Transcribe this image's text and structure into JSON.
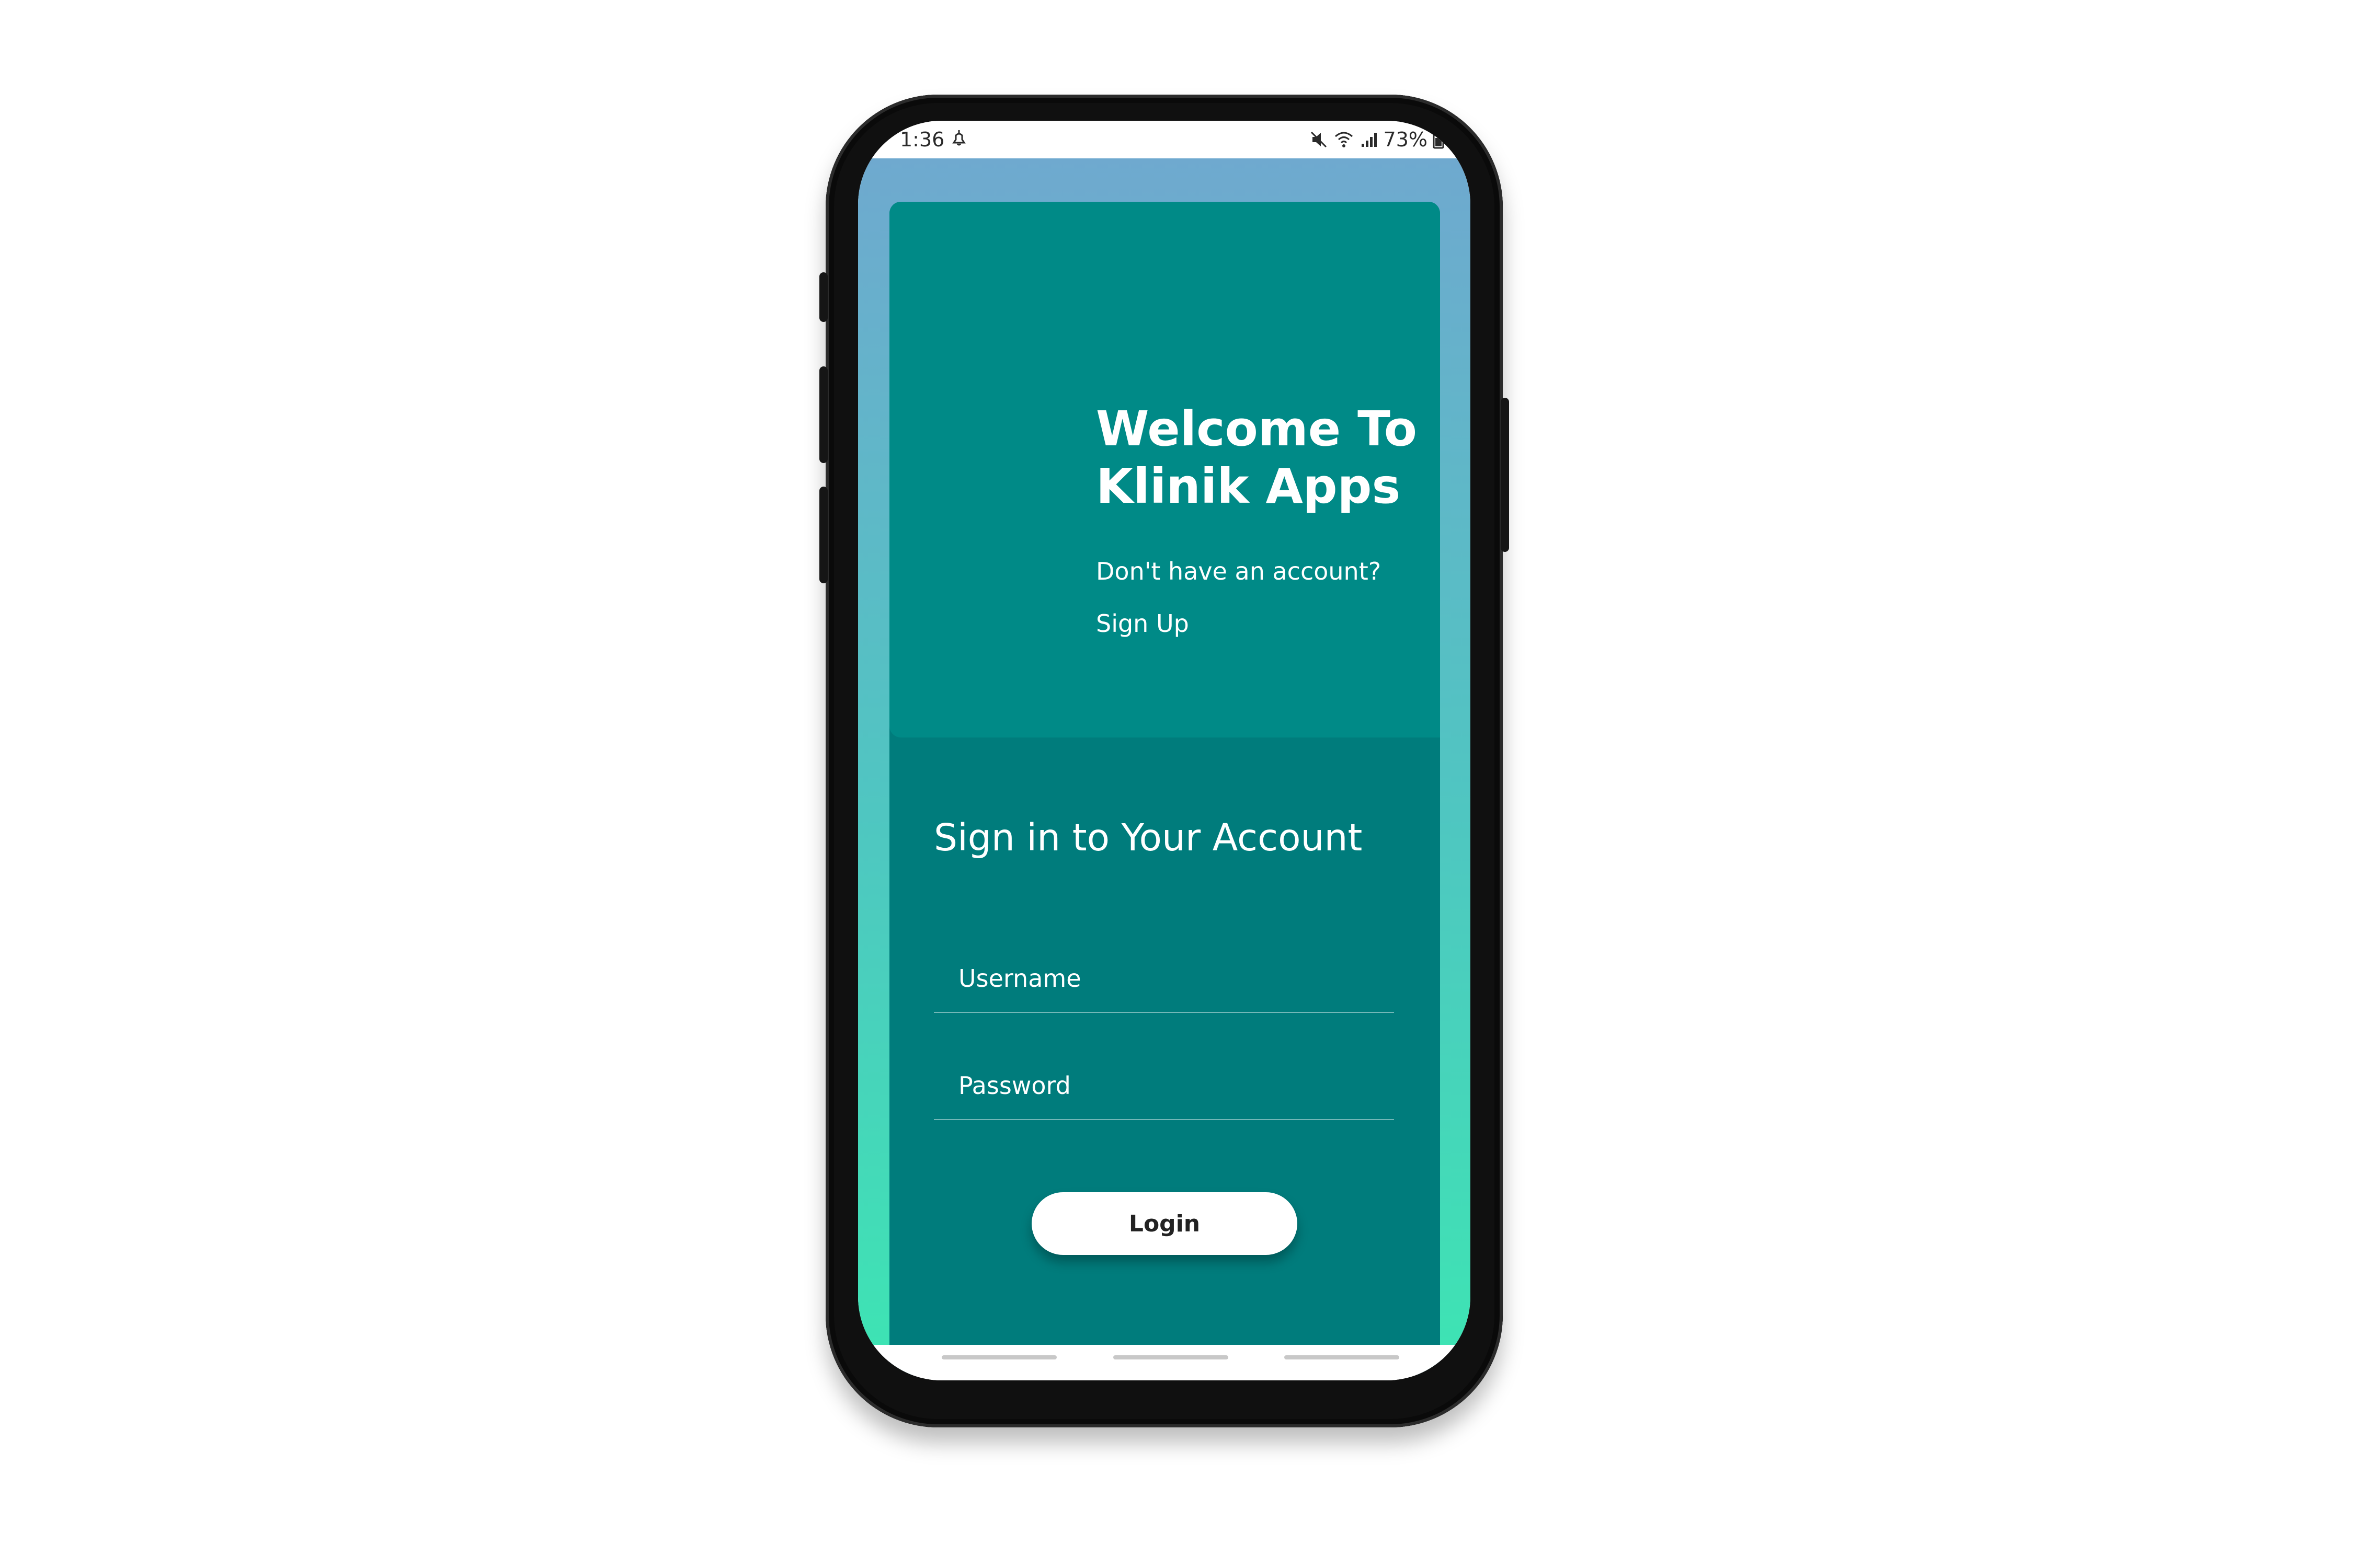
{
  "status_bar": {
    "time": "1:36",
    "battery": "73%"
  },
  "welcome": {
    "title": "Welcome To Klinik Apps",
    "no_account_text": "Don't have an account?",
    "signup_label": "Sign Up"
  },
  "signin": {
    "title": "Sign in to Your Account",
    "username_placeholder": "Username",
    "password_placeholder": "Password",
    "login_label": "Login"
  },
  "colors": {
    "card_top": "#008a87",
    "card_bottom": "#007c7c",
    "gradient_top": "#6fa9cf",
    "gradient_bottom": "#3ee3b4"
  }
}
